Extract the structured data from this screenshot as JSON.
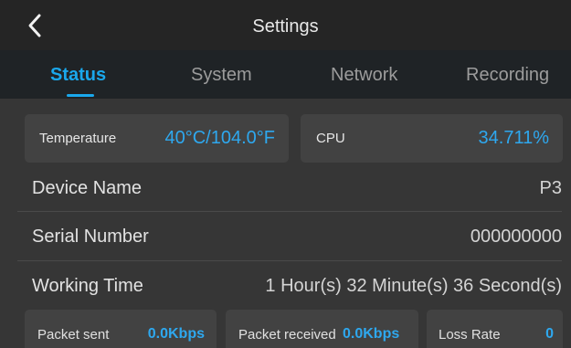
{
  "header": {
    "title": "Settings",
    "back_icon": "chevron-left-icon"
  },
  "tabs": [
    {
      "label": "Status",
      "active": true
    },
    {
      "label": "System",
      "active": false
    },
    {
      "label": "Network",
      "active": false
    },
    {
      "label": "Recording",
      "active": false
    }
  ],
  "metrics": {
    "temperature": {
      "label": "Temperature",
      "value": "40°C/104.0°F"
    },
    "cpu": {
      "label": "CPU",
      "value": "34.711%"
    }
  },
  "info": [
    {
      "label": "Device Name",
      "value": "P3"
    },
    {
      "label": "Serial Number",
      "value": "000000000"
    },
    {
      "label": "Working Time",
      "value": "1 Hour(s) 32 Minute(s) 36 Second(s)"
    }
  ],
  "network_stats": {
    "packet_sent": {
      "label": "Packet sent",
      "value": "0.0Kbps"
    },
    "packet_received": {
      "label": "Packet received",
      "value": "0.0Kbps"
    },
    "loss_rate": {
      "label": "Loss Rate",
      "value": "0"
    }
  },
  "colors": {
    "accent": "#1aa8ec",
    "background": "#363636",
    "header": "#252525",
    "tabbar": "#1f2326",
    "card": "#424242"
  }
}
